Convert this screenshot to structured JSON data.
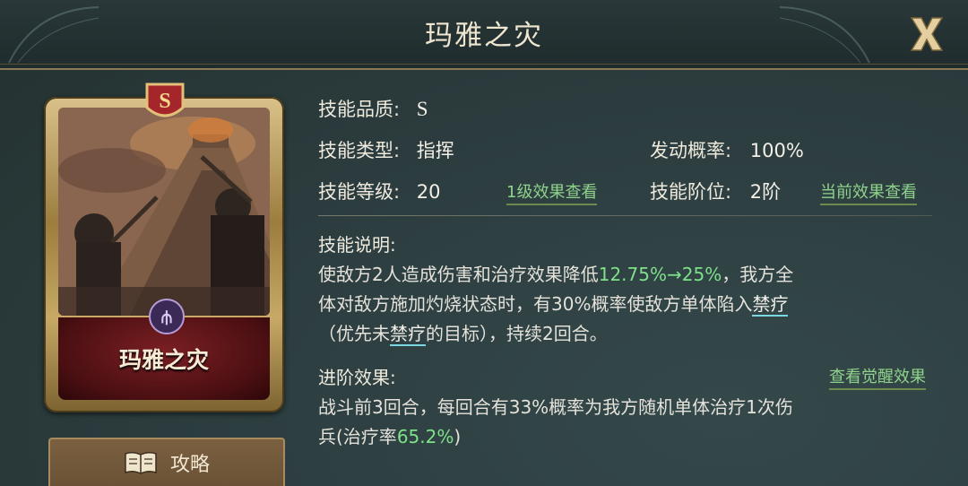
{
  "window": {
    "title": "玛雅之灾",
    "close_label": "X"
  },
  "card": {
    "grade": "S",
    "name": "玛雅之灾",
    "class_icon": "trident-icon"
  },
  "guide_button": {
    "label": "攻略",
    "icon": "book-icon"
  },
  "info": {
    "quality_label": "技能品质:",
    "quality_value": "S",
    "type_label": "技能类型:",
    "type_value": "指挥",
    "trigger_label": "发动概率:",
    "trigger_value": "100%",
    "level_label": "技能等级:",
    "level_value": "20",
    "level_link": "1级效果查看",
    "tier_label": "技能阶位:",
    "tier_value": "2阶",
    "tier_link": "当前效果查看"
  },
  "description": {
    "heading": "技能说明:",
    "line1_prefix": "使敌方2人造成伤害和治疗效果降低",
    "line1_value": "12.75%→25%",
    "line1_suffix": "，我方全",
    "line2_prefix": "体对敌方施加灼烧状态时，有30%概率使敌方单体陷入",
    "keyword1": "禁疗",
    "line3_prefix": "（优先未",
    "keyword2": "禁疗",
    "line3_suffix": "的目标），持续2回合。"
  },
  "advanced": {
    "heading": "进阶效果:",
    "link": "查看觉醒效果",
    "line1": "战斗前3回合，每回合有33%概率为我方随机单体治疗1次伤",
    "line2_prefix": "兵(治疗率",
    "line2_value": "65.2%",
    "line2_suffix": ")"
  },
  "colors": {
    "accent_green": "#7fe08a",
    "link_green": "#8fd28b",
    "keyword_underline": "#7ad8e0",
    "frame_gold": "#c7a965"
  }
}
